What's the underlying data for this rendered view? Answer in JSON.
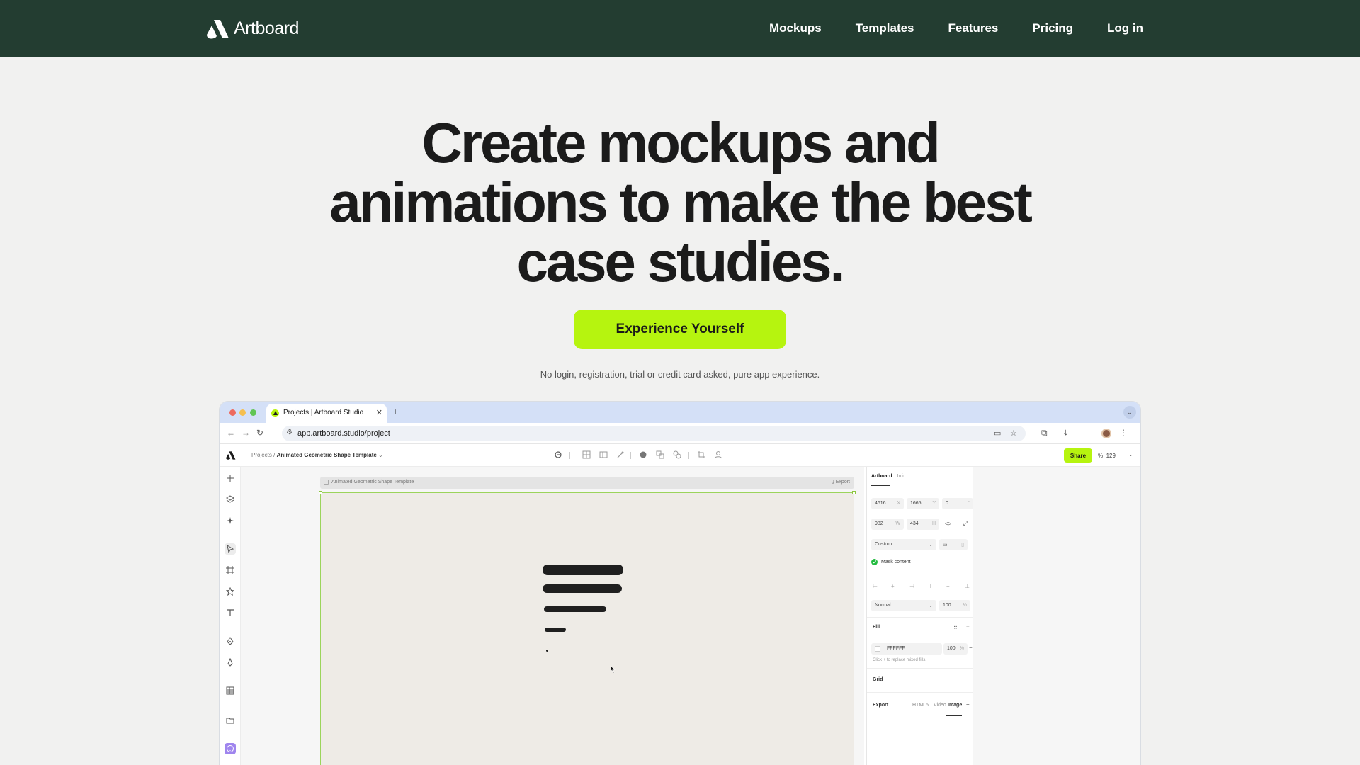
{
  "nav": {
    "brand": "Artboard",
    "links": [
      "Mockups",
      "Templates",
      "Features",
      "Pricing",
      "Log in"
    ]
  },
  "hero": {
    "title": "Create mockups and animations to make the best case studies.",
    "cta": "Experience Yourself",
    "note": "No login, registration, trial or credit card asked, pure app experience."
  },
  "browser": {
    "tab_title": "Projects | Artboard Studio",
    "tab_close": "✕",
    "new_tab": "+",
    "url": "app.artboard.studio/project"
  },
  "app": {
    "breadcrumb_root": "Projects /",
    "breadcrumb_current": "Animated Geometric Shape Template",
    "share": "Share",
    "zoom_percent_sign": "%",
    "zoom": "129",
    "frame_label": "Animated Geometric Shape Template",
    "frame_export": "Export"
  },
  "inspector": {
    "tab_artboard": "Artboard",
    "tab_info": "Info",
    "x": "4616",
    "x_unit": "X",
    "y": "1665",
    "y_unit": "Y",
    "r": "0",
    "r_unit": "°",
    "w": "982",
    "w_unit": "W",
    "h": "434",
    "h_unit": "H",
    "preset": "Custom",
    "mask_label": "Mask content",
    "blend": "Normal",
    "opacity": "100",
    "percent": "%",
    "fill_label": "Fill",
    "fill_hex": "FFFFFF",
    "fill_opacity": "100",
    "fill_note": "Click + to replace mixed fills.",
    "grid_label": "Grid",
    "export_label": "Export",
    "export_tabs": [
      "HTML5",
      "Video",
      "Image"
    ]
  }
}
